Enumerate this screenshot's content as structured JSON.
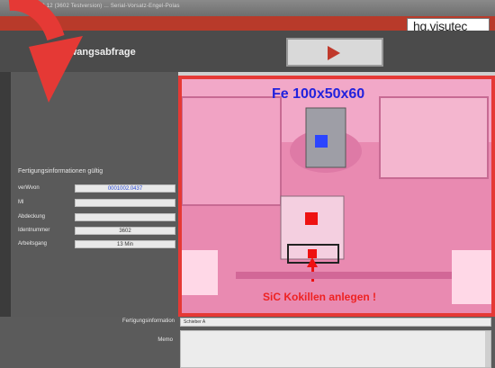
{
  "window": {
    "title": "Geneo 1.8.12 (3602 Testversion)    ...    Serial-Vorsatz-Engel-Polas"
  },
  "brand": {
    "logo_text": "hg.visutec"
  },
  "header": {
    "title": "Zwangsabfrage"
  },
  "play_button": {
    "icon": "play-icon",
    "color": "#c0392b"
  },
  "info": {
    "section_title": "Fertigungsinformationen gültig",
    "rows": [
      {
        "label": "verWvon",
        "value": "0001002.0437",
        "highlight": true
      },
      {
        "label": "Ml",
        "value": ""
      },
      {
        "label": "Abdeckung",
        "value": ""
      },
      {
        "label": "Identnummer",
        "value": "3602"
      },
      {
        "label": "Arbeitsgang",
        "value": "13 Min"
      }
    ]
  },
  "photo": {
    "caption_top": "Fe 100x50x60",
    "caption_bottom": "SiC Kokillen anlegen !"
  },
  "bottom": {
    "fertigung_label": "Fertigungsinformation",
    "fertigung_value": "Schieber A",
    "memo_label": "Memo",
    "memo_value": ""
  },
  "colors": {
    "accent": "#e53935",
    "header_bg": "#4b4b4b",
    "panel_bg": "#5a5a5a",
    "blue_text": "#2222dd"
  }
}
